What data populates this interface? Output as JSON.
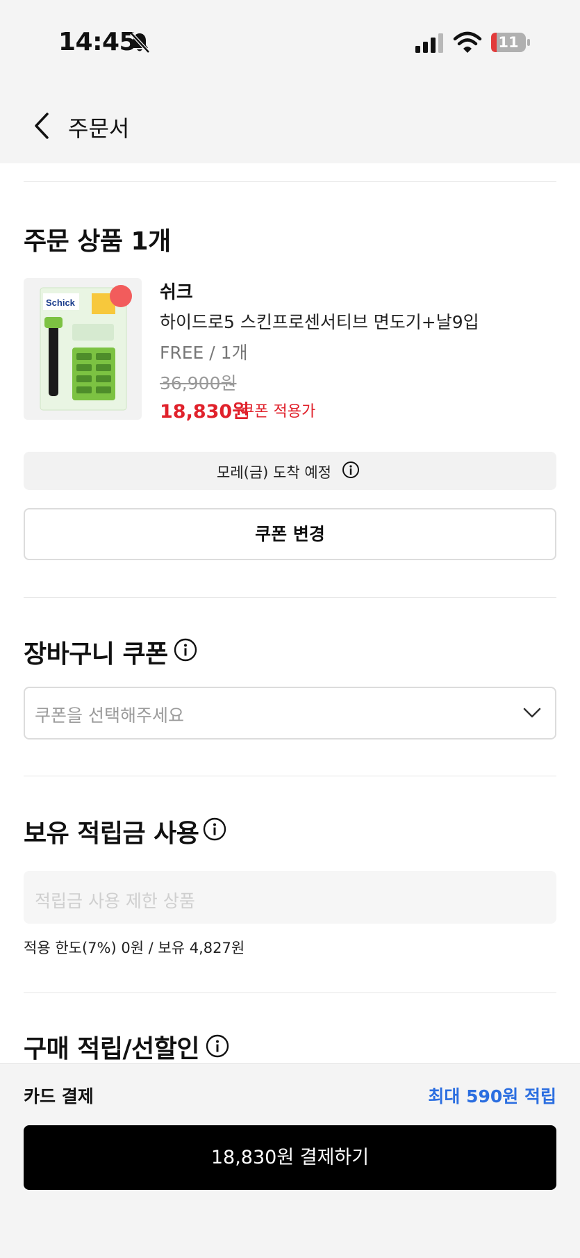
{
  "status_bar": {
    "time": "14:45",
    "battery_level": "11",
    "icons": [
      "bell-slash-icon",
      "signal-icon",
      "wifi-icon",
      "battery-icon"
    ]
  },
  "header": {
    "title": "주문서",
    "back_icon": "chevron-left-icon"
  },
  "order_items": {
    "title": "주문 상품 1개",
    "product": {
      "brand": "쉬크",
      "name": "하이드로5 스킨프로센서티브 면도기+날9입",
      "option": "FREE / 1개",
      "original_price": "36,900원",
      "sale_price": "18,830원",
      "coupon_label": "쿠폰 적용가",
      "image_label": "Schick"
    },
    "delivery": "모레(금) 도착 예정",
    "coupon_button": "쿠폰 변경"
  },
  "cart_coupon": {
    "title": "장바구니 쿠폰",
    "placeholder": "쿠폰을 선택해주세요"
  },
  "points": {
    "title": "보유 적립금 사용",
    "placeholder": "적립금 사용 제한 상품",
    "info": "적용 한도(7%) 0원 / 보유 4,827원"
  },
  "purchase_reward": {
    "title": "구매 적립/선할인"
  },
  "footer": {
    "payment_method": "카드 결제",
    "reward": "최대 590원 적립",
    "pay_button": "18,830원 결제하기"
  },
  "colors": {
    "accent_red": "#e0212b",
    "accent_blue": "#2b6ee0",
    "pay_button": "#000000"
  }
}
